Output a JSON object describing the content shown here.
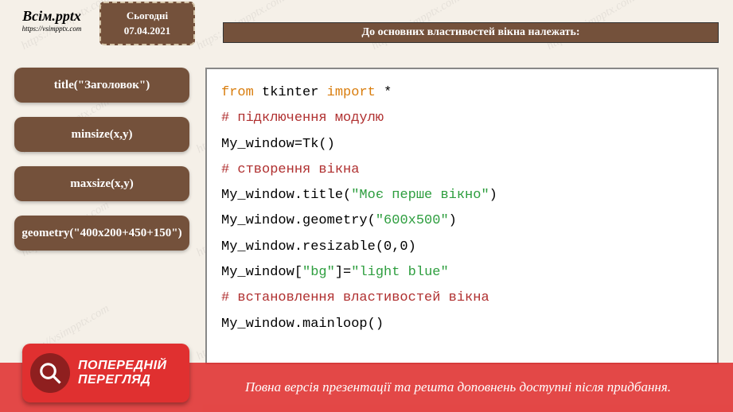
{
  "logo": {
    "title": "Всім.pptx",
    "url": "https://vsimpptx.com"
  },
  "date_badge": {
    "label": "Сьогодні",
    "date": "07.04.2021"
  },
  "heading": "До основних властивостей вікна належать:",
  "props": [
    "title(\"Заголовок\")",
    "minsize(x,y)",
    "maxsize(x,y)",
    "geometry(\"400x200+450+150\")"
  ],
  "code": {
    "l1a": "from",
    "l1b": "tkinter",
    "l1c": "import",
    "l1d": "*",
    "l2": "# підключення модулю",
    "l3": "My_window=Tk()",
    "l4": "# створення вікна",
    "l5a": "My_window.title(",
    "l5b": "\"Моє перше вікно\"",
    "l5c": ")",
    "l6a": "My_window.geometry(",
    "l6b": "\"600x500\"",
    "l6c": ")",
    "l7": "My_window.resizable(0,0)",
    "l8a": "My_window[",
    "l8b": "\"bg\"",
    "l8c": "]=",
    "l8d": "\"light blue\"",
    "l9": "# встановлення властивостей вікна",
    "l10": "My_window.mainloop()"
  },
  "preview_badge": {
    "line1": "ПОПЕРЕДНІЙ",
    "line2": "ПЕРЕГЛЯД"
  },
  "bottom_notice": "Повна версія презентації та решта доповнень доступні після придбання.",
  "watermark": "https://vsimpptx.com"
}
